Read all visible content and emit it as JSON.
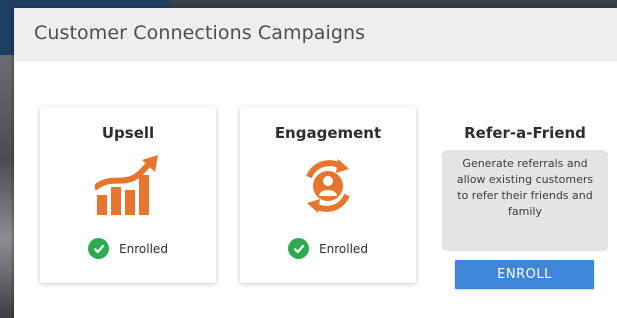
{
  "panel": {
    "title": "Customer Connections Campaigns"
  },
  "campaigns": [
    {
      "title": "Upsell",
      "icon": "growth-chart-icon",
      "status": "Enrolled",
      "status_icon": "check-circle-icon"
    },
    {
      "title": "Engagement",
      "icon": "engagement-cycle-icon",
      "status": "Enrolled",
      "status_icon": "check-circle-icon"
    }
  ],
  "refer_a_friend": {
    "title": "Refer-a-Friend",
    "description": "Generate referrals and allow existing customers to refer their friends and family",
    "button_label": "ENROLL"
  },
  "colors": {
    "accent_orange": "#e8752e",
    "success_green": "#2fab4f",
    "button_blue": "#3f86d8"
  }
}
